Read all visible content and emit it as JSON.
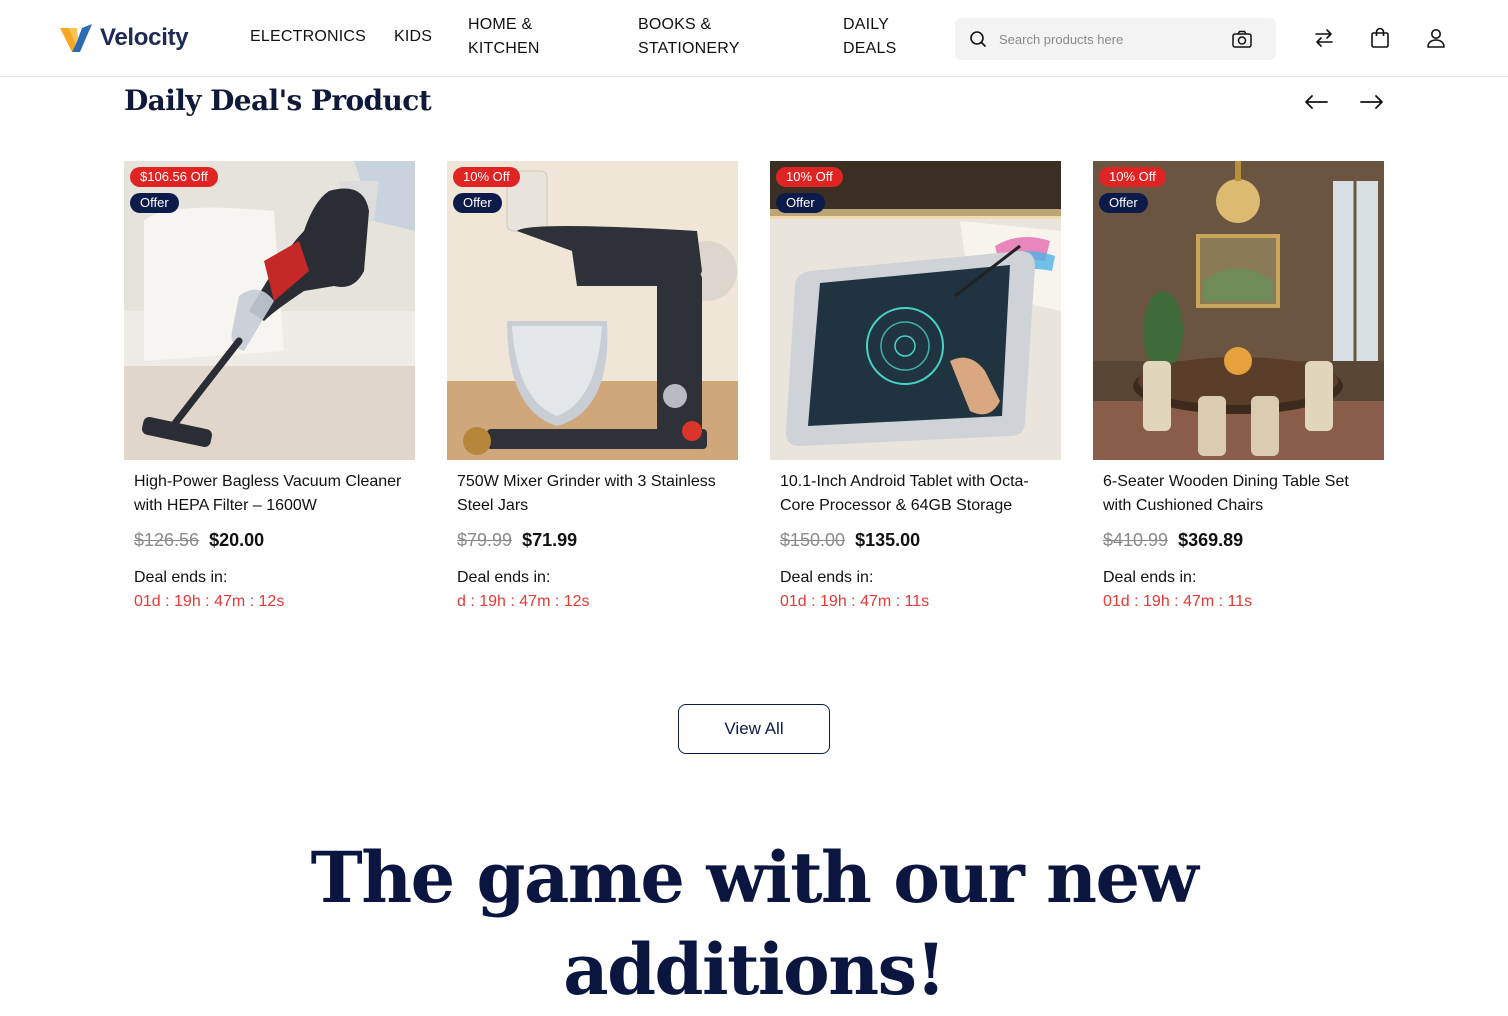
{
  "brand": {
    "name": "Velocity"
  },
  "nav": {
    "items": [
      {
        "label": "ELECTRONICS"
      },
      {
        "label": "KIDS"
      },
      {
        "label": "HOME & KITCHEN"
      },
      {
        "label": "BOOKS & STATIONERY"
      },
      {
        "label": "DAILY DEALS"
      }
    ]
  },
  "search": {
    "placeholder": "Search products here"
  },
  "header_icons": [
    "compare-arrows-icon",
    "shopping-bag-icon",
    "user-icon"
  ],
  "deals": {
    "title": "Daily Deal's Product",
    "products": [
      {
        "discount_badge": "$106.56 Off",
        "offer_badge": "Offer",
        "title": "High-Power Bagless Vacuum Cleaner with HEPA Filter – 1600W",
        "old_price": "$126.56",
        "price": "$20.00",
        "deal_label": "Deal ends in:",
        "countdown": "01d : 19h : 47m : 12s"
      },
      {
        "discount_badge": "10% Off",
        "offer_badge": "Offer",
        "title": "750W Mixer Grinder with 3 Stainless Steel Jars",
        "old_price": "$79.99",
        "price": "$71.99",
        "deal_label": "Deal ends in:",
        "countdown": "d : 19h : 47m : 12s"
      },
      {
        "discount_badge": "10% Off",
        "offer_badge": "Offer",
        "title": "10.1-Inch Android Tablet with Octa-Core Processor & 64GB Storage",
        "old_price": "$150.00",
        "price": "$135.00",
        "deal_label": "Deal ends in:",
        "countdown": "01d : 19h : 47m : 11s"
      },
      {
        "discount_badge": "10% Off",
        "offer_badge": "Offer",
        "title": "6-Seater Wooden Dining Table Set with Cushioned Chairs",
        "old_price": "$410.99",
        "price": "$369.89",
        "deal_label": "Deal ends in:",
        "countdown": "01d : 19h : 47m : 11s"
      }
    ],
    "view_all_label": "View All"
  },
  "hero": {
    "title": "The game with our new additions!"
  },
  "colors": {
    "navy": "#0d1b4b",
    "discount_red": "#e02424",
    "countdown_red": "#e53935",
    "logo_orange": "#f5a623",
    "logo_blue": "#2b6cb0"
  }
}
